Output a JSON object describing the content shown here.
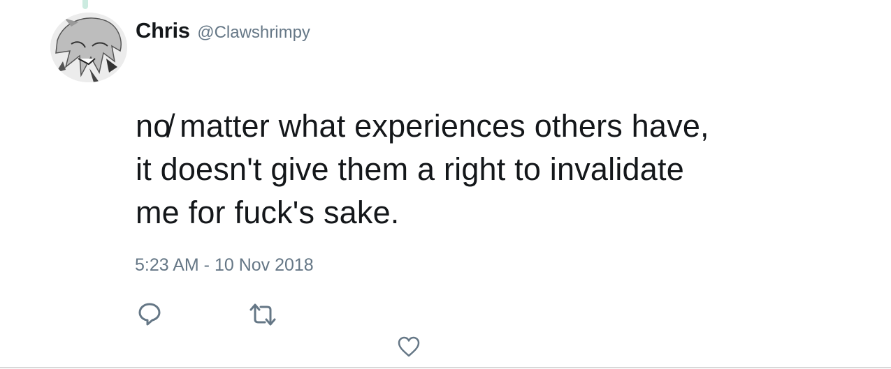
{
  "tweet": {
    "display_name": "Chris",
    "handle": "@Clawshrimpy",
    "text_lines": [
      "no̸ matter what experiences others have,",
      "it doesn't give them a right to invalidate",
      "me for fuck's sake."
    ],
    "timestamp": "5:23 AM - 10 Nov 2018"
  },
  "icons": {
    "avatar": "anime-avatar",
    "reply": "reply-icon",
    "retweet": "retweet-icon",
    "like": "heart-icon"
  },
  "colors": {
    "text": "#14171a",
    "secondary": "#657786",
    "thread": "#ccebe0"
  }
}
